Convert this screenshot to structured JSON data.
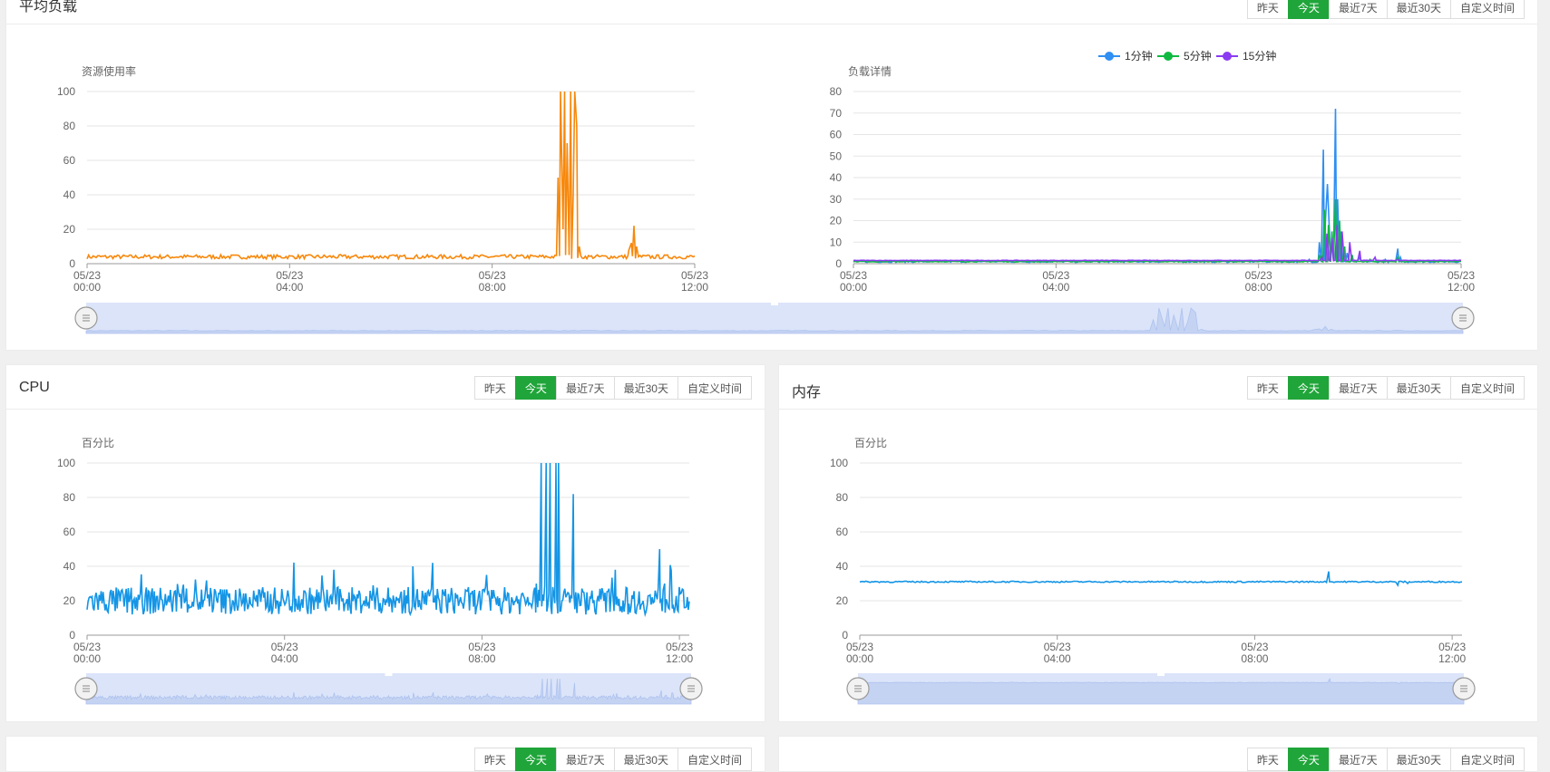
{
  "range_buttons": [
    "昨天",
    "今天",
    "最近7天",
    "最近30天",
    "自定义时间"
  ],
  "active_range_index": 1,
  "colors": {
    "accent": "#20a53a",
    "orange": "#f7880c",
    "blue": "#1495e6",
    "blue_load": "#2f8ff2",
    "green": "#0fb93f",
    "purple": "#8b3bf2",
    "grid": "#e6e6e6",
    "axis_text": "#666",
    "zoom_fill": "#dbe4f9"
  },
  "panels": {
    "load": {
      "title": "平均负载"
    },
    "cpu": {
      "title": "CPU"
    },
    "memory": {
      "title": "内存"
    }
  },
  "chart_data": [
    {
      "id": "load-usage",
      "type": "line",
      "ylabel": "资源使用率",
      "ylim": [
        0,
        100
      ],
      "yticks": [
        0,
        20,
        40,
        60,
        80,
        100
      ],
      "xticks": [
        "05/23\n00:00",
        "05/23\n04:00",
        "05/23\n08:00",
        "05/23\n12:00"
      ],
      "xlim_hours": [
        0,
        12
      ],
      "grid": true,
      "series": [
        {
          "color": "#f7880c",
          "baseline": 4,
          "noise": 1.2,
          "spikes": [
            [
              9.3,
              50
            ],
            [
              9.35,
              100
            ],
            [
              9.4,
              20
            ],
            [
              9.43,
              100
            ],
            [
              9.48,
              70
            ],
            [
              9.52,
              5
            ],
            [
              9.55,
              100
            ],
            [
              9.6,
              40
            ],
            [
              9.63,
              100
            ],
            [
              9.67,
              80
            ],
            [
              9.72,
              10
            ],
            [
              10.7,
              8
            ],
            [
              10.75,
              12
            ],
            [
              10.8,
              22
            ],
            [
              10.85,
              10
            ]
          ]
        }
      ]
    },
    {
      "id": "load-detail",
      "type": "line",
      "ylabel": "负载详情",
      "ylim": [
        0,
        80
      ],
      "yticks": [
        0,
        10,
        20,
        30,
        40,
        50,
        60,
        70,
        80
      ],
      "xticks": [
        "05/23\n00:00",
        "05/23\n04:00",
        "05/23\n08:00",
        "05/23\n12:00"
      ],
      "xlim_hours": [
        0,
        12
      ],
      "grid": true,
      "legend": "top-center",
      "series": [
        {
          "name": "1分钟",
          "color": "#2f8ff2",
          "baseline": 1,
          "noise": 0.4,
          "spikes": [
            [
              9.0,
              2
            ],
            [
              9.2,
              10
            ],
            [
              9.28,
              53
            ],
            [
              9.32,
              20
            ],
            [
              9.36,
              37
            ],
            [
              9.4,
              15
            ],
            [
              9.45,
              10
            ],
            [
              9.52,
              72
            ],
            [
              9.56,
              30
            ],
            [
              9.62,
              15
            ],
            [
              9.75,
              5
            ],
            [
              10.0,
              3
            ],
            [
              10.5,
              2
            ],
            [
              10.75,
              7
            ],
            [
              10.8,
              3
            ]
          ]
        },
        {
          "name": "5分钟",
          "color": "#0fb93f",
          "baseline": 1,
          "noise": 0.2,
          "spikes": [
            [
              9.2,
              4
            ],
            [
              9.3,
              25
            ],
            [
              9.38,
              18
            ],
            [
              9.45,
              15
            ],
            [
              9.52,
              30
            ],
            [
              9.6,
              20
            ],
            [
              9.7,
              8
            ],
            [
              9.85,
              4
            ],
            [
              10.2,
              2
            ],
            [
              10.75,
              3
            ]
          ]
        },
        {
          "name": "15分钟",
          "color": "#8b3bf2",
          "baseline": 1.5,
          "noise": 0.1,
          "spikes": [
            [
              9.25,
              3
            ],
            [
              9.35,
              14
            ],
            [
              9.45,
              12
            ],
            [
              9.55,
              18
            ],
            [
              9.65,
              15
            ],
            [
              9.8,
              10
            ],
            [
              10.0,
              6
            ],
            [
              10.3,
              3
            ],
            [
              10.75,
              2
            ]
          ]
        }
      ]
    },
    {
      "id": "cpu",
      "type": "line",
      "ylabel": "百分比",
      "ylim": [
        0,
        100
      ],
      "yticks": [
        0,
        20,
        40,
        60,
        80,
        100
      ],
      "xticks": [
        "05/23\n00:00",
        "05/23\n04:00",
        "05/23\n08:00",
        "05/23\n12:00"
      ],
      "xlim_hours": [
        0,
        12.2
      ],
      "grid": true,
      "series": [
        {
          "color": "#1495e6",
          "baseline": 20,
          "noise": 8,
          "spikes": [
            [
              5.0,
              38
            ],
            [
              6.6,
              40
            ],
            [
              7.0,
              42
            ],
            [
              9.1,
              30
            ],
            [
              9.2,
              100
            ],
            [
              9.25,
              20
            ],
            [
              9.3,
              100
            ],
            [
              9.38,
              100
            ],
            [
              9.45,
              25
            ],
            [
              9.5,
              100
            ],
            [
              9.55,
              100
            ],
            [
              9.62,
              20
            ],
            [
              9.85,
              82
            ],
            [
              9.9,
              25
            ],
            [
              10.7,
              38
            ],
            [
              11.6,
              50
            ],
            [
              11.7,
              30
            ]
          ]
        }
      ]
    },
    {
      "id": "memory",
      "type": "line",
      "ylabel": "百分比",
      "ylim": [
        0,
        100
      ],
      "yticks": [
        0,
        20,
        40,
        60,
        80,
        100
      ],
      "xticks": [
        "05/23\n00:00",
        "05/23\n04:00",
        "05/23\n08:00",
        "05/23\n12:00"
      ],
      "xlim_hours": [
        0,
        12.2
      ],
      "grid": true,
      "series": [
        {
          "color": "#1495e6",
          "baseline": 31,
          "noise": 0.4,
          "spikes": [
            [
              9.4,
              31
            ],
            [
              9.5,
              37
            ],
            [
              9.55,
              31
            ],
            [
              10.8,
              31
            ],
            [
              10.9,
              29
            ],
            [
              11.1,
              30
            ]
          ]
        }
      ]
    }
  ]
}
